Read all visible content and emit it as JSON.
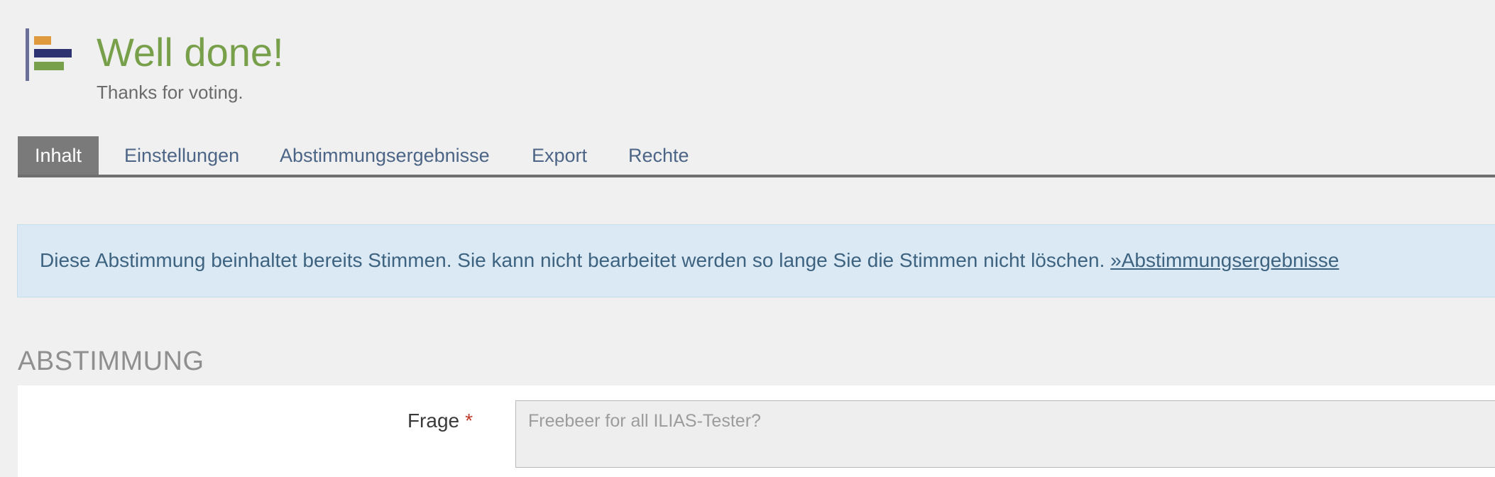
{
  "header": {
    "icon": "poll-icon",
    "title": "Well done!",
    "subtitle": "Thanks for voting."
  },
  "tabs": [
    {
      "label": "Inhalt",
      "active": true
    },
    {
      "label": "Einstellungen",
      "active": false
    },
    {
      "label": "Abstimmungsergebnisse",
      "active": false
    },
    {
      "label": "Export",
      "active": false
    },
    {
      "label": "Rechte",
      "active": false
    }
  ],
  "alert": {
    "message": "Diese Abstimmung beinhaltet bereits Stimmen. Sie kann nicht bearbeitet werden so lange Sie die Stimmen nicht löschen.",
    "link_text": "»Abstimmungsergebnisse"
  },
  "section": {
    "title": "ABSTIMMUNG"
  },
  "form": {
    "question_label": "Frage",
    "required_marker": "*",
    "question_placeholder": "Freebeer for all ILIAS-Tester?"
  },
  "colors": {
    "title_green": "#78a04b",
    "tab_active_bg": "#7a7a7a",
    "tab_text": "#4c6586",
    "alert_bg": "#dbe9f4",
    "alert_text": "#3d6380",
    "required_red": "#c33a2c",
    "icon_orange": "#e09a3e",
    "icon_navy": "#2d3270",
    "icon_green": "#78a04b",
    "icon_bar": "#6a6f98"
  }
}
